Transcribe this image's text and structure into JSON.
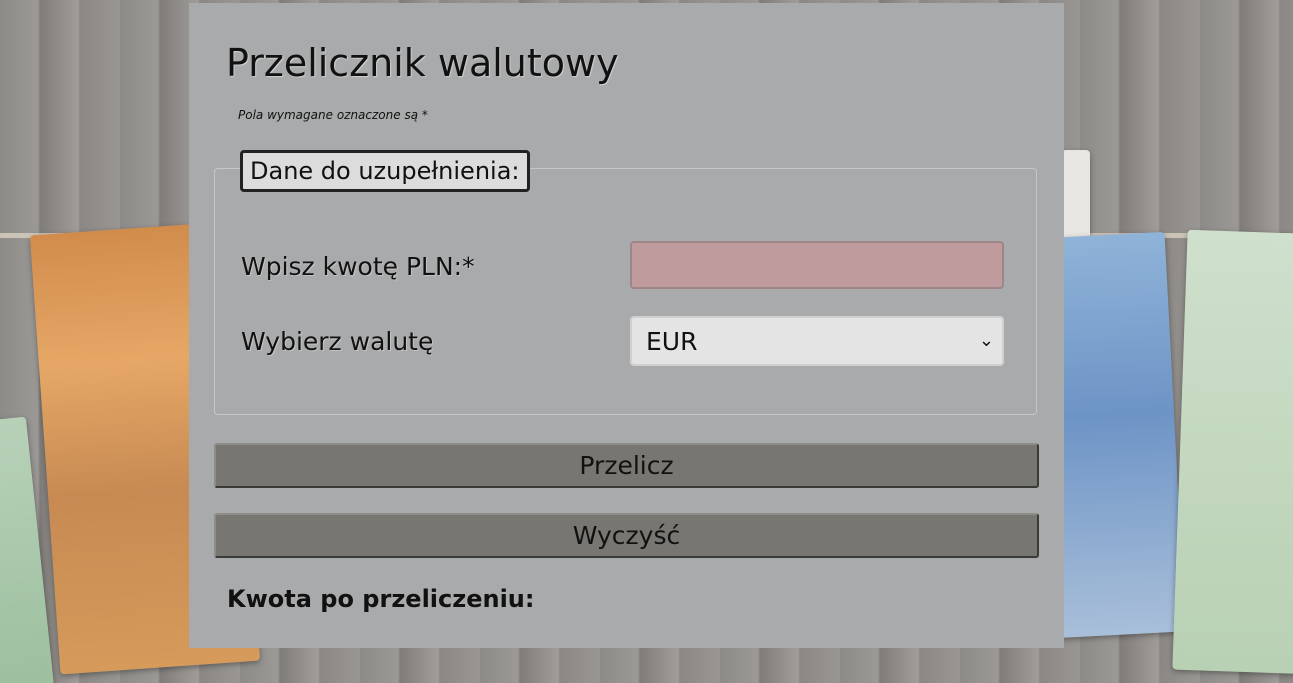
{
  "page": {
    "title": "Przelicznik walutowy",
    "required_note": "Pola wymagane oznaczone są *"
  },
  "form": {
    "legend": "Dane do uzupełnienia:",
    "amount_label": "Wpisz kwotę PLN:*",
    "amount_value": "",
    "currency_label": "Wybierz walutę",
    "currency_selected": "EUR"
  },
  "buttons": {
    "calculate": "Przelicz",
    "clear": "Wyczyść"
  },
  "result": {
    "label": "Kwota po przeliczeniu:"
  },
  "colors": {
    "panel_bg": "#a9aaab",
    "input_bg": "#bf9b9d",
    "button_bg": "#787670"
  },
  "icons": {
    "select_arrow": "chevron-down-icon"
  }
}
